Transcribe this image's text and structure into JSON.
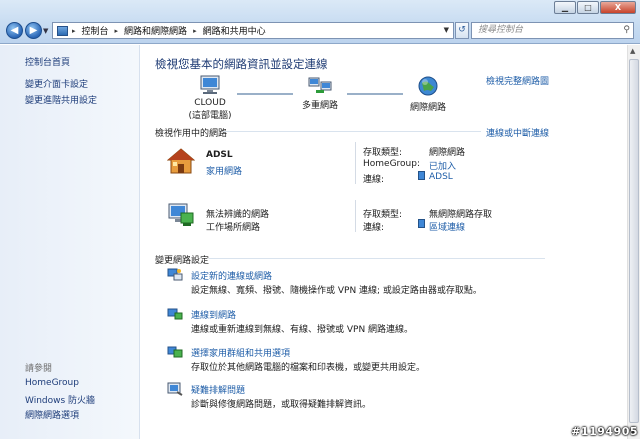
{
  "window": {
    "minimize": "▁",
    "maximize": "□",
    "close": "X"
  },
  "nav": {
    "back": "◀",
    "forward": "▶",
    "dropdown": "▼"
  },
  "address": {
    "crumbs": [
      "控制台",
      "網路和網際網路",
      "網路和共用中心"
    ],
    "separator": "▸",
    "dropdown": "▼"
  },
  "refresh_glyph": "↺",
  "search": {
    "placeholder": "搜尋控制台",
    "icon": "⚲"
  },
  "sidebar": {
    "items": [
      "控制台首頁",
      "變更介面卡設定",
      "變更進階共用設定"
    ],
    "see_also_heading": "請參閱",
    "see_also": [
      "HomeGroup",
      "Windows 防火牆",
      "網際網路選項"
    ]
  },
  "main": {
    "title": "檢視您基本的網路資訊並設定連線",
    "full_map_link": "檢視完整網路圖",
    "map": {
      "computer_name": "CLOUD",
      "computer_sub": "(這部電腦)",
      "middle": "多重網路",
      "internet": "網際網路"
    },
    "active_heading": "檢視作用中的網路",
    "connect_link": "連線或中斷連線",
    "networks": [
      {
        "name": "ADSL",
        "type": "家用網路",
        "access_label": "存取類型:",
        "access_value": "網際網路",
        "homegroup_label": "HomeGroup:",
        "homegroup_value": "已加入",
        "connection_label": "連線:",
        "connection_value": "ADSL"
      },
      {
        "name": "無法辨識的網路",
        "type": "工作場所網路",
        "access_label": "存取類型:",
        "access_value": "無網際網路存取",
        "connection_label": "連線:",
        "connection_value": "區域連線"
      }
    ],
    "change_heading": "變更網路設定",
    "tasks": [
      {
        "link": "設定新的連線或網路",
        "desc": "設定無線、寬頻、撥號、隨機操作或 VPN 連線; 或設定路由器或存取點。"
      },
      {
        "link": "連線到網路",
        "desc": "連線或重新連線到無線、有線、撥號或 VPN 網路連線。"
      },
      {
        "link": "選擇家用群組和共用選項",
        "desc": "存取位於其他網路電腦的檔案和印表機，或變更共用設定。"
      },
      {
        "link": "疑難排解問題",
        "desc": "診斷與修復網路問題，或取得疑難排解資訊。"
      }
    ]
  },
  "scrollbar": {
    "up": "▲",
    "down": "▼"
  },
  "watermark": "#1194905"
}
